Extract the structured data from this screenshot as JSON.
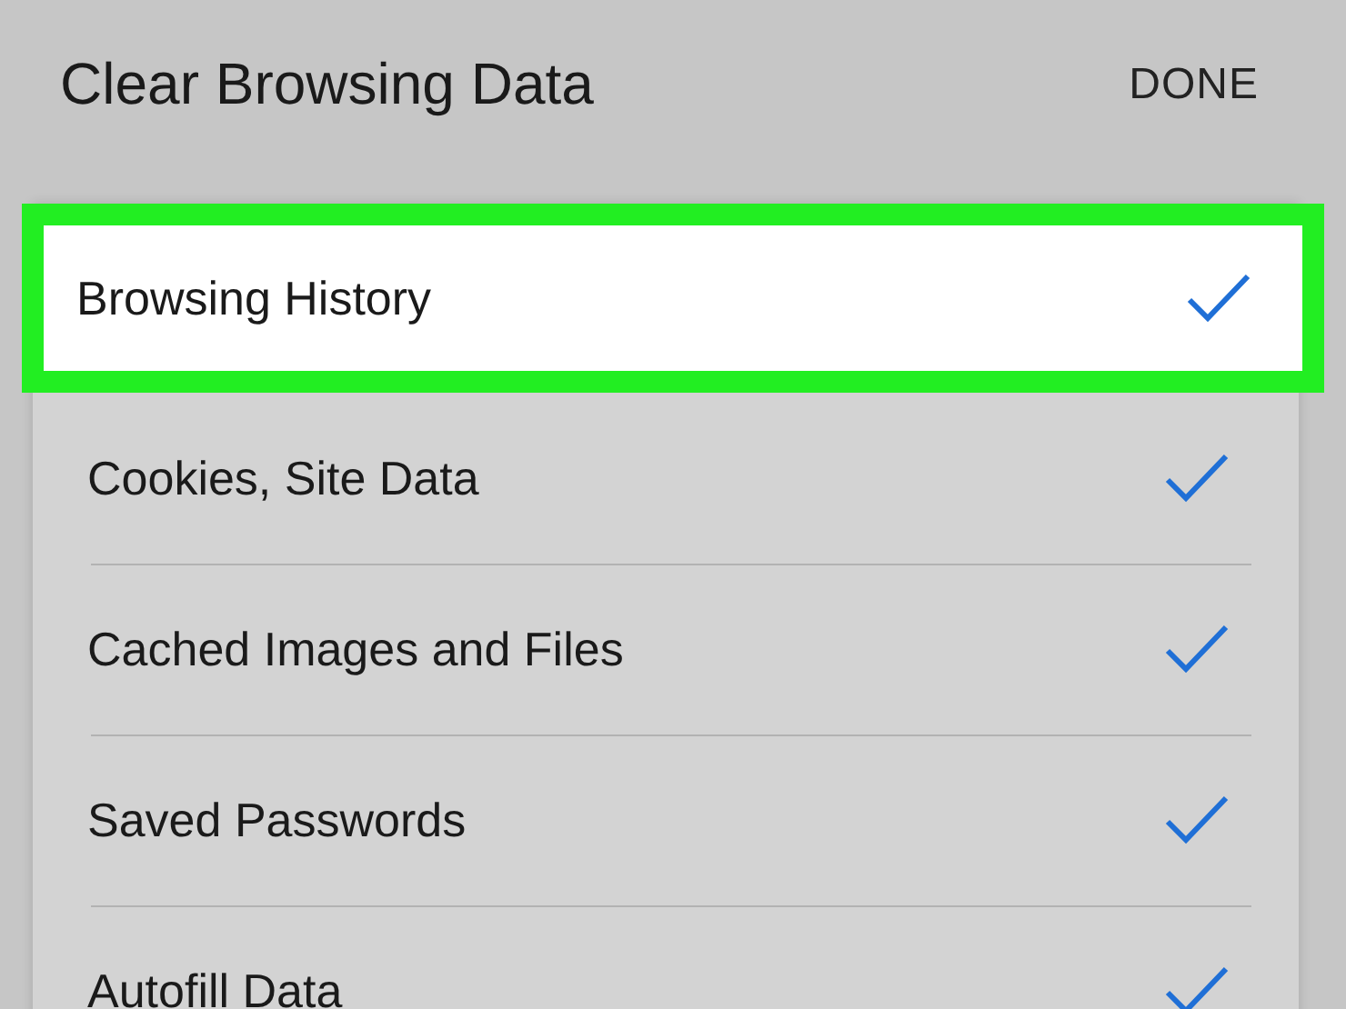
{
  "header": {
    "title": "Clear Browsing Data",
    "done_button": "DONE"
  },
  "items": [
    {
      "label": "Browsing History",
      "checked": true,
      "highlighted": true
    },
    {
      "label": "Cookies, Site Data",
      "checked": true,
      "highlighted": false
    },
    {
      "label": "Cached Images and Files",
      "checked": true,
      "highlighted": false
    },
    {
      "label": "Saved Passwords",
      "checked": true,
      "highlighted": false
    },
    {
      "label": "Autofill Data",
      "checked": true,
      "highlighted": false
    }
  ]
}
